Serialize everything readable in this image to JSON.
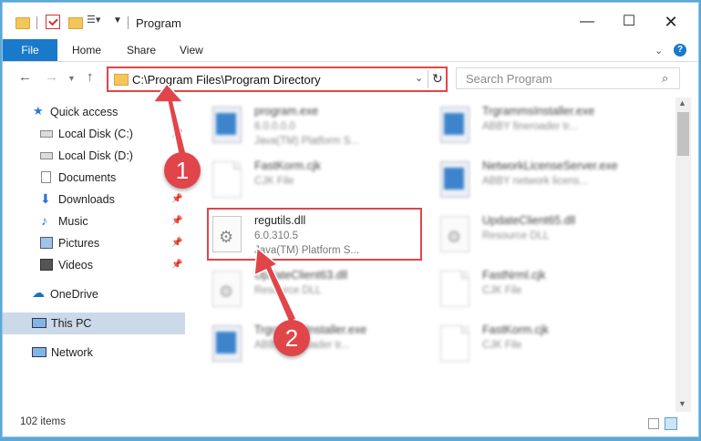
{
  "window": {
    "title": "Program"
  },
  "ribbon": {
    "file": "File",
    "home": "Home",
    "share": "Share",
    "view": "View"
  },
  "address": {
    "path": "C:\\Program Files\\Program Directory"
  },
  "search": {
    "placeholder": "Search Program"
  },
  "sidebar": {
    "items": [
      {
        "label": "Quick access"
      },
      {
        "label": "Local Disk (C:)"
      },
      {
        "label": "Local Disk (D:)"
      },
      {
        "label": "Documents"
      },
      {
        "label": "Downloads"
      },
      {
        "label": "Music"
      },
      {
        "label": "Pictures"
      },
      {
        "label": "Videos"
      },
      {
        "label": "OneDrive"
      },
      {
        "label": "This PC"
      },
      {
        "label": "Network"
      }
    ]
  },
  "files": [
    {
      "name": "program.exe",
      "line1": "6.0.0.0.0",
      "line2": "Java(TM) Platform S...",
      "icon": "exe-icon"
    },
    {
      "name": "TrgrammsInstaller.exe",
      "line1": "ABBY fineroader tr...",
      "line2": "",
      "icon": "exe-icon"
    },
    {
      "name": "FastKorm.cjk",
      "line1": "CJK File",
      "line2": "",
      "icon": "document-icon"
    },
    {
      "name": "NetworkLicenseServer.exe",
      "line1": "ABBY network licens...",
      "line2": "",
      "icon": "exe-icon"
    },
    {
      "name": "regutils.dll",
      "line1": "6.0.310.5",
      "line2": "Java(TM) Platform S...",
      "icon": "dll-gear-icon"
    },
    {
      "name": "UpdateClient65.dll",
      "line1": "Resource DLL",
      "line2": "",
      "icon": "dll-gear-icon"
    },
    {
      "name": "UpdateClient63.dll",
      "line1": "Resource DLL",
      "line2": "",
      "icon": "dll-gear-icon"
    },
    {
      "name": "FastNrml.cjk",
      "line1": "CJK File",
      "line2": "",
      "icon": "document-icon"
    },
    {
      "name": "TrgrammsInstaller.exe",
      "line1": "ABBY fineroader tr...",
      "line2": "",
      "icon": "exe-icon"
    },
    {
      "name": "FastKorm.cjk",
      "line1": "CJK File",
      "line2": "",
      "icon": "document-icon"
    }
  ],
  "status": {
    "count": "102 items"
  },
  "annotations": {
    "step1": "1",
    "step2": "2",
    "color": "#e0454a"
  }
}
